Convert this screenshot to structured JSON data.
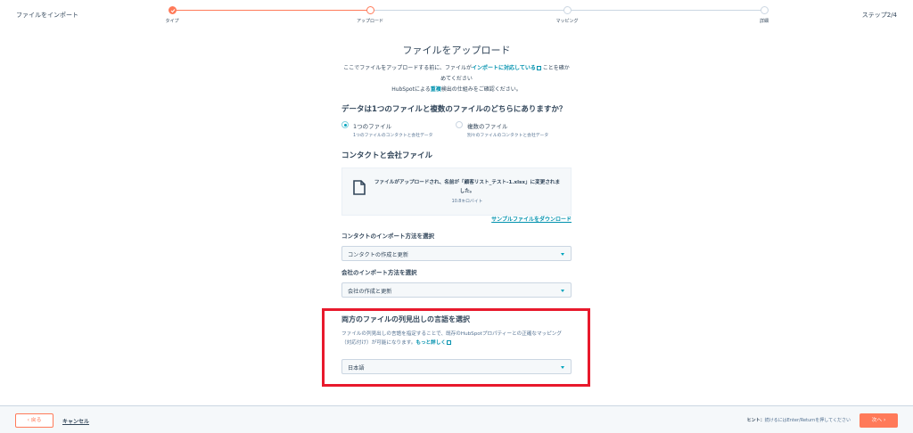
{
  "header": {
    "title": "ファイルをインポート",
    "step_counter": "ステップ2/4",
    "steps": [
      {
        "label": "タイプ",
        "status": "complete"
      },
      {
        "label": "アップロード",
        "status": "active"
      },
      {
        "label": "マッピング",
        "status": "pending"
      },
      {
        "label": "詳細",
        "status": "pending"
      }
    ]
  },
  "main": {
    "title": "ファイルをアップロード",
    "intro_line1_a": "ここでファイルをアップロードする前に、ファイルが",
    "intro_link": "インポートに対応している",
    "intro_line1_b": "ことを確かめてください",
    "intro_line2_a": "HubSpotによる",
    "intro_line2_link": "重複",
    "intro_line2_b": "検出の仕組みをご確認ください。",
    "question": "データは1つのファイルと複数のファイルのどちらにありますか？",
    "radio_options": [
      {
        "label": "1つのファイル",
        "sub": "1つのファイルのコンタクトと会社データ",
        "selected": true
      },
      {
        "label": "複数のファイル",
        "sub": "別々のファイルのコンタクトと会社データ",
        "selected": false
      }
    ],
    "file_section_title": "コンタクトと会社ファイル",
    "file_message": "ファイルがアップロードされ、名前が「顧客リスト_テスト-1.xlsx」に変更されました。",
    "file_size": "10.8キロバイト",
    "sample_link": "サンプルファイルをダウンロード",
    "contact_import_label": "コンタクトのインポート方法を選択",
    "contact_import_value": "コンタクトの作成と更新",
    "company_import_label": "会社のインポート方法を選択",
    "company_import_value": "会社の作成と更新",
    "lang_title": "両方のファイルの列見出しの言語を選択",
    "lang_desc": "ファイルの列見出しの言語を指定することで、既存のHubSpotプロパティーとの正確なマッピング（対応付け）が可能になります。",
    "lang_link": "もっと詳しく",
    "lang_value": "日本語"
  },
  "footer": {
    "back_label": "戻る",
    "cancel_label": "キャンセル",
    "hint_bold": "ヒント：",
    "hint_text": "続けるにはEnter/Returnを押してください",
    "next_label": "次へ"
  },
  "colors": {
    "accent": "#ff7a59",
    "link": "#0091ae",
    "highlight": "#e8192c"
  }
}
